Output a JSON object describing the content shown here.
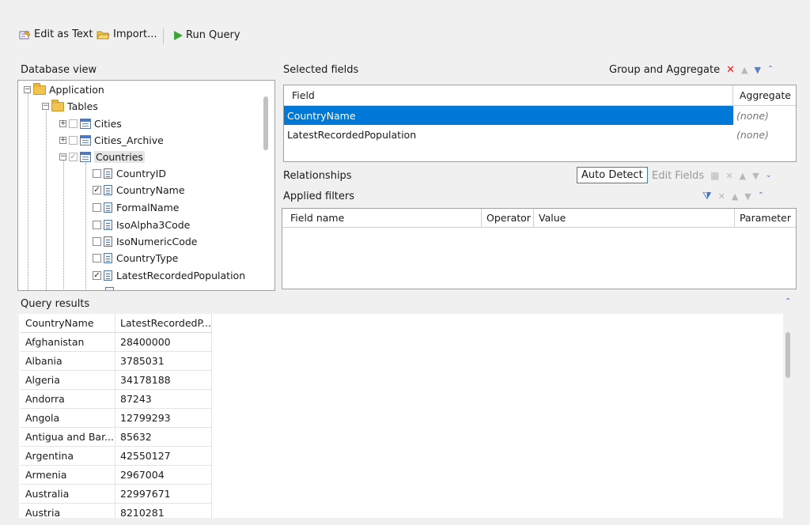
{
  "toolbar": {
    "edit_as_text": "Edit as Text",
    "import": "Import...",
    "run_query": "Run Query"
  },
  "database_view": {
    "title": "Database view",
    "root": "Application",
    "tables_folder": "Tables",
    "tables": [
      "Cities",
      "Cities_Archive",
      "Countries"
    ],
    "fields": [
      {
        "name": "CountryID",
        "checked": false
      },
      {
        "name": "CountryName",
        "checked": true
      },
      {
        "name": "FormalName",
        "checked": false
      },
      {
        "name": "IsoAlpha3Code",
        "checked": false
      },
      {
        "name": "IsoNumericCode",
        "checked": false
      },
      {
        "name": "CountryType",
        "checked": false
      },
      {
        "name": "LatestRecordedPopulation",
        "checked": true
      }
    ]
  },
  "selected_fields": {
    "title": "Selected fields",
    "group_and_aggregate": "Group and Aggregate",
    "col_field": "Field",
    "col_aggregate": "Aggregate",
    "rows": [
      {
        "field": "CountryName",
        "aggregate": "(none)",
        "selected": true
      },
      {
        "field": "LatestRecordedPopulation",
        "aggregate": "(none)",
        "selected": false
      }
    ]
  },
  "relationships": {
    "title": "Relationships",
    "auto_detect": "Auto Detect",
    "edit_fields": "Edit Fields"
  },
  "applied_filters": {
    "title": "Applied filters",
    "col_field_name": "Field name",
    "col_operator": "Operator",
    "col_value": "Value",
    "col_parameter": "Parameter"
  },
  "query_results": {
    "title": "Query results",
    "columns": [
      "CountryName",
      "LatestRecordedP..."
    ],
    "rows": [
      [
        "Afghanistan",
        "28400000"
      ],
      [
        "Albania",
        "3785031"
      ],
      [
        "Algeria",
        "34178188"
      ],
      [
        "Andorra",
        "87243"
      ],
      [
        "Angola",
        "12799293"
      ],
      [
        "Antigua and Bar...",
        "85632"
      ],
      [
        "Argentina",
        "42550127"
      ],
      [
        "Armenia",
        "2967004"
      ],
      [
        "Australia",
        "22997671"
      ],
      [
        "Austria",
        "8210281"
      ]
    ]
  },
  "colors": {
    "selection": "#0078d7",
    "run_green": "#3fa535",
    "delete_red": "#e02020",
    "arrow_blue": "#3a6fd0"
  }
}
